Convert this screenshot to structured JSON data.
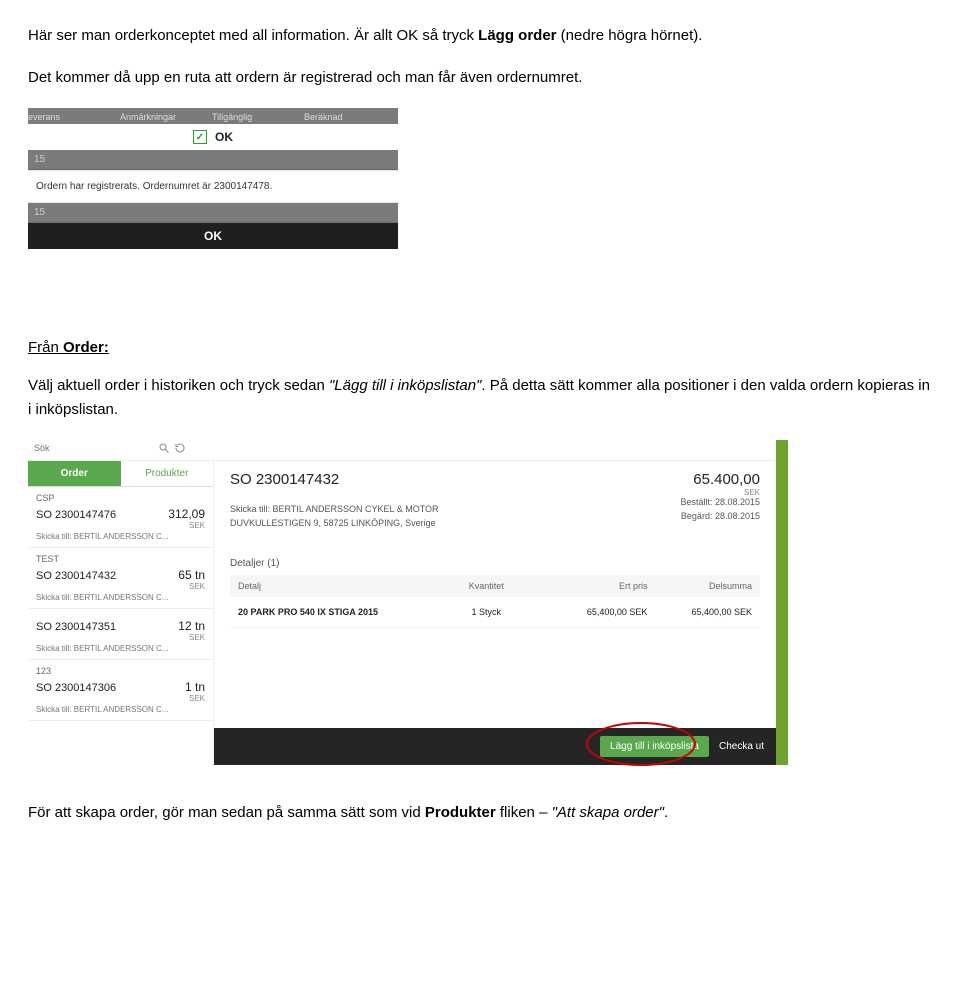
{
  "doc": {
    "p1_a": "Här ser man orderkonceptet med all information. Är allt OK så tryck ",
    "p1_b": "Lägg order",
    "p1_c": " (nedre högra hörnet).",
    "p2": "Det kommer då upp en ruta att ordern är registrerad och man får även ordernumret.",
    "h1_a": "Från ",
    "h1_b": "Order:",
    "p3_a": "Välj aktuell order i historiken och tryck sedan ",
    "p3_q1": "\"Lägg till i inköpslistan\"",
    "p3_b": ". På detta sätt kommer alla positioner i den valda ordern kopieras in i inköpslistan.",
    "p4_a": "För att skapa order, gör man sedan på samma sätt som vid ",
    "p4_b": "Produkter",
    "p4_c": " fliken – ",
    "p4_q2": "\"Att skapa order\"",
    "p4_d": "."
  },
  "shot1": {
    "cols": [
      "everans",
      "Anmärkningar",
      "Tillgänglig",
      "Beräknad"
    ],
    "row15": "15",
    "ok_label": "OK",
    "message": "Ordern har registrerats. Ordernumret är 2300147478.",
    "ok_button": "OK"
  },
  "shot2": {
    "search_placeholder": "Sök",
    "tabs": {
      "order": "Order",
      "produkter": "Produkter"
    },
    "sidebar": [
      {
        "tag": "CSP",
        "so": "SO 2300147476",
        "amt": "312,09",
        "unit": "SEK",
        "ship": "Skicka till: BERTIL ANDERSSON C..."
      },
      {
        "tag": "TEST",
        "so": "SO 2300147432",
        "amt": "65 tn",
        "unit": "SEK",
        "ship": "Skicka till: BERTIL ANDERSSON C..."
      },
      {
        "tag": "",
        "so": "SO 2300147351",
        "amt": "12 tn",
        "unit": "SEK",
        "ship": "Skicka till: BERTIL ANDERSSON C..."
      },
      {
        "tag": "123",
        "so": "SO 2300147306",
        "amt": "1 tn",
        "unit": "SEK",
        "ship": "Skicka till: BERTIL ANDERSSON C..."
      }
    ],
    "detail": {
      "so": "SO 2300147432",
      "amount": "65.400,00",
      "amount_unit": "SEK",
      "addr1": "Skicka till: BERTIL ANDERSSON CYKEL & MOTOR",
      "addr2": "DUVKULLESTIGEN 9, 58725 LINKÖPING, Sverige",
      "ordered_label": "Beställt: 28.08.2015",
      "requested_label": "Begärd: 28.08.2015",
      "details_label": "Detaljer (1)",
      "thead": {
        "c1": "Detalj",
        "c2": "Kvantitet",
        "c3": "Ert pris",
        "c4": "Delsumma"
      },
      "row": {
        "c1": "20 PARK PRO 540 IX STIGA 2015",
        "c2": "1 Styck",
        "c3": "65,400,00 SEK",
        "c4": "65,400,00 SEK"
      }
    },
    "bottom": {
      "add": "Lägg till i inköpslista",
      "checkout": "Checka ut"
    }
  }
}
